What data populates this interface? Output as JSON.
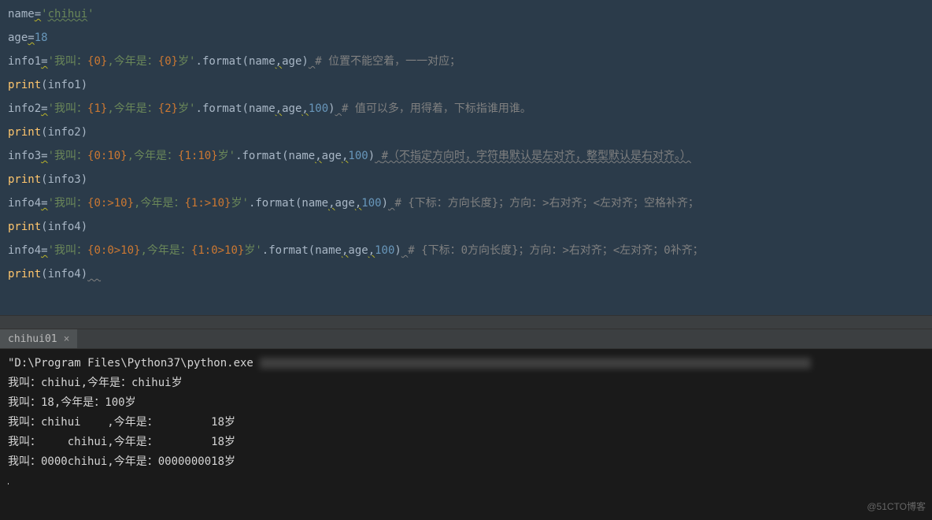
{
  "editor": {
    "lines_raw": [
      "name='chihui'",
      "age=18",
      "info1='我叫：{0},今年是：{0}岁'.format(name,age) # 位置不能空着，一一对应；",
      "print(info1)",
      "info2='我叫：{1},今年是：{2}岁'.format(name,age,100) # 值可以多，用得着，下标指谁用谁。",
      "print(info2)",
      "info3='我叫：{0:10},今年是：{1:10}岁'.format(name,age,100) #（不指定方向时，字符串默认是左对齐，整型默认是右对齐。）",
      "print(info3)",
      "info4='我叫：{0:>10},今年是：{1:>10}岁'.format(name,age,100) # {下标：方向长度}；方向：>右对齐；<左对齐；空格补齐；",
      "print(info4)",
      "info4='我叫：{0:0>10},今年是：{1:0>10}岁'.format(name,age,100) # {下标：0方向长度}；方向：>右对齐；<左对齐；0补齐；",
      "print(info4)"
    ]
  },
  "tab": {
    "label": "chihui01",
    "close": "×"
  },
  "console": {
    "path": "\"D:\\Program Files\\Python37\\python.exe",
    "lines": [
      "我叫：chihui,今年是：chihui岁",
      "我叫：18,今年是：100岁",
      "我叫：chihui    ,今年是：        18岁",
      "我叫：    chihui,今年是：        18岁",
      "我叫：0000chihui,今年是：0000000018岁"
    ]
  },
  "watermark": "@51CTO博客"
}
